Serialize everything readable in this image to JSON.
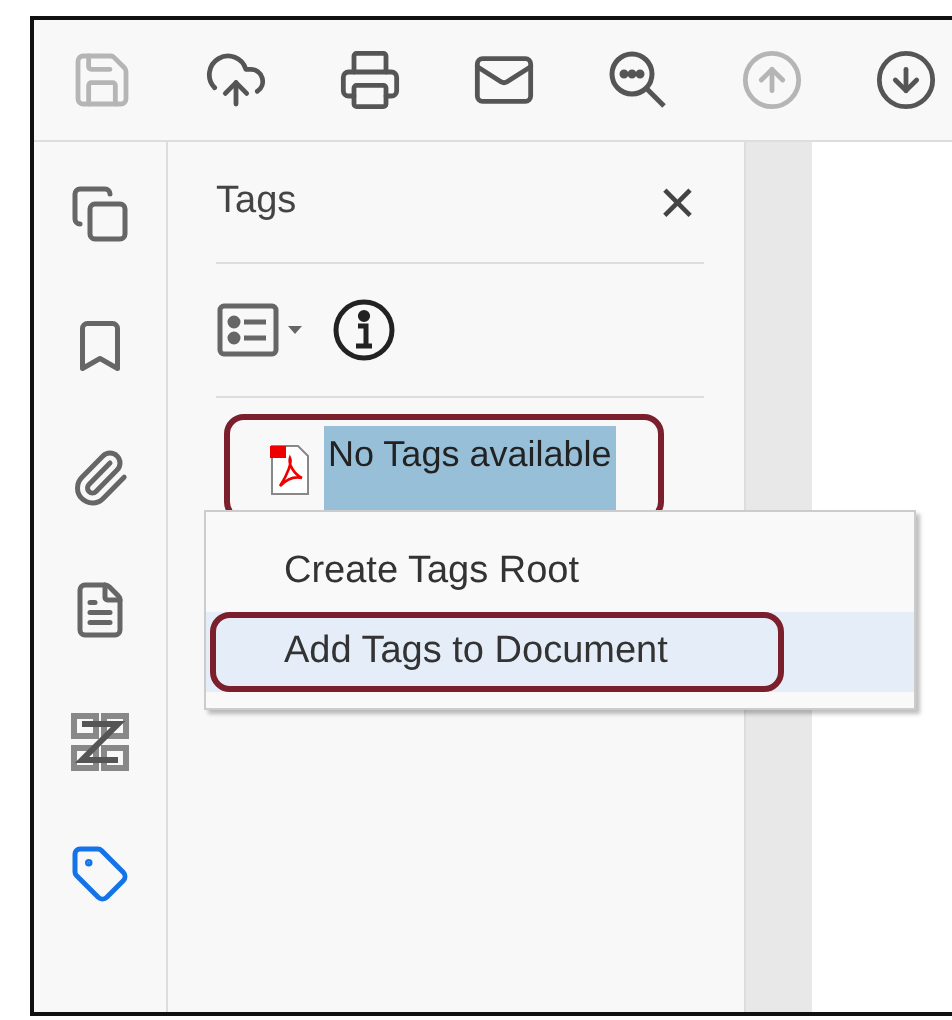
{
  "toolbar": [
    {
      "kind": "save",
      "disabled": true
    },
    {
      "kind": "upload",
      "disabled": false
    },
    {
      "kind": "print",
      "disabled": false
    },
    {
      "kind": "mail",
      "disabled": false
    },
    {
      "kind": "search",
      "disabled": false
    },
    {
      "kind": "up",
      "disabled": true
    },
    {
      "kind": "down",
      "disabled": false
    }
  ],
  "rail": [
    {
      "kind": "pages",
      "selected": false
    },
    {
      "kind": "bookmarks",
      "selected": false
    },
    {
      "kind": "attachments",
      "selected": false
    },
    {
      "kind": "document",
      "selected": false
    },
    {
      "kind": "order",
      "selected": false
    },
    {
      "kind": "tags",
      "selected": true
    }
  ],
  "panel": {
    "title": "Tags",
    "close": "×",
    "tree": [
      {
        "label": "No Tags available",
        "selected": true,
        "outlined": true
      }
    ]
  },
  "context_menu": [
    {
      "label": "Create Tags Root",
      "selected": false,
      "outlined": false
    },
    {
      "label": "Add Tags to Document",
      "selected": true,
      "outlined": true
    }
  ]
}
